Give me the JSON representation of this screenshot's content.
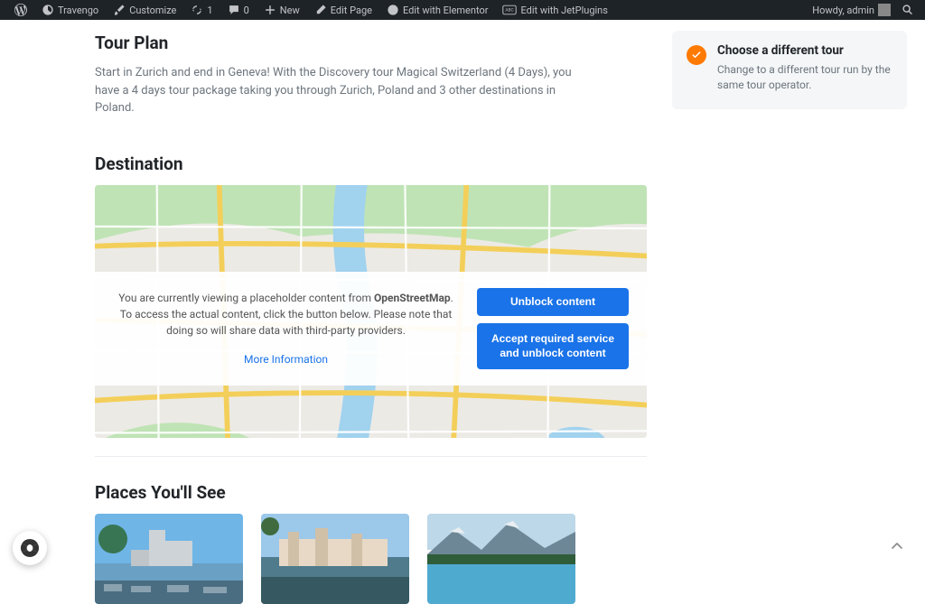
{
  "adminbar": {
    "site_name": "Travengo",
    "customize": "Customize",
    "updates_count": "1",
    "comments_count": "0",
    "new": "New",
    "edit_page": "Edit Page",
    "edit_elementor": "Edit with Elementor",
    "edit_jetplugins": "Edit with JetPlugins",
    "howdy": "Howdy, admin"
  },
  "sections": {
    "tour_plan": {
      "title": "Tour Plan",
      "desc": "Start in Zurich and end in Geneva! With the Discovery tour Magical Switzerland (4 Days), you have a 4 days tour package taking you through Zurich, Poland and 3 other destinations in Poland."
    },
    "destination": {
      "title": "Destination"
    },
    "places": {
      "title": "Places You'll See"
    }
  },
  "sidebar_card": {
    "title": "Choose a different tour",
    "desc": "Change to a different tour run by the same tour operator."
  },
  "map": {
    "notice_prefix": "You are currently viewing a placeholder content from ",
    "notice_provider": "OpenStreetMap",
    "notice_suffix": ". To access the actual content, click the button below. Please note that doing so will share data with third-party providers.",
    "more_info": "More Information",
    "unblock": "Unblock content",
    "accept": "Accept required service and unblock content"
  }
}
